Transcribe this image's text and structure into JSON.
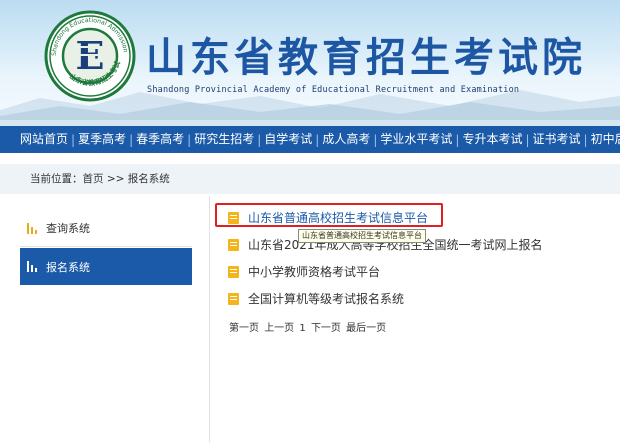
{
  "header": {
    "logo_ring_text": "Shandong Educational Admission & Examination",
    "logo_bottom_text": "山东省教育招生考试",
    "logo_letter": "E",
    "title": "山东省教育招生考试院",
    "subtitle": "Shandong Provincial Academy of Educational Recruitment and Examination"
  },
  "nav": {
    "items": [
      "网站首页",
      "夏季高考",
      "春季高考",
      "研究生招考",
      "自学考试",
      "成人高考",
      "学业水平考试",
      "专升本考试",
      "证书考试",
      "初中后高"
    ]
  },
  "breadcrumb": "当前位置：首页 >> 报名系统",
  "sidebar": {
    "items": [
      {
        "label": "查询系统"
      },
      {
        "label": "报名系统"
      }
    ]
  },
  "content": {
    "links": [
      "山东省普通高校招生考试信息平台",
      "山东省2021年成人高等学校招生全国统一考试网上报名",
      "中小学教师资格考试平台",
      "全国计算机等级考试报名系统"
    ],
    "tooltip": "山东省普通高校招生考试信息平台",
    "pager": {
      "first": "第一页",
      "prev": "上一页",
      "current": "1",
      "next": "下一页",
      "last": "最后一页"
    }
  },
  "colors": {
    "brand_blue": "#1a5aa8",
    "accent_gold": "#e8a91c",
    "highlight_red": "#e02020"
  }
}
